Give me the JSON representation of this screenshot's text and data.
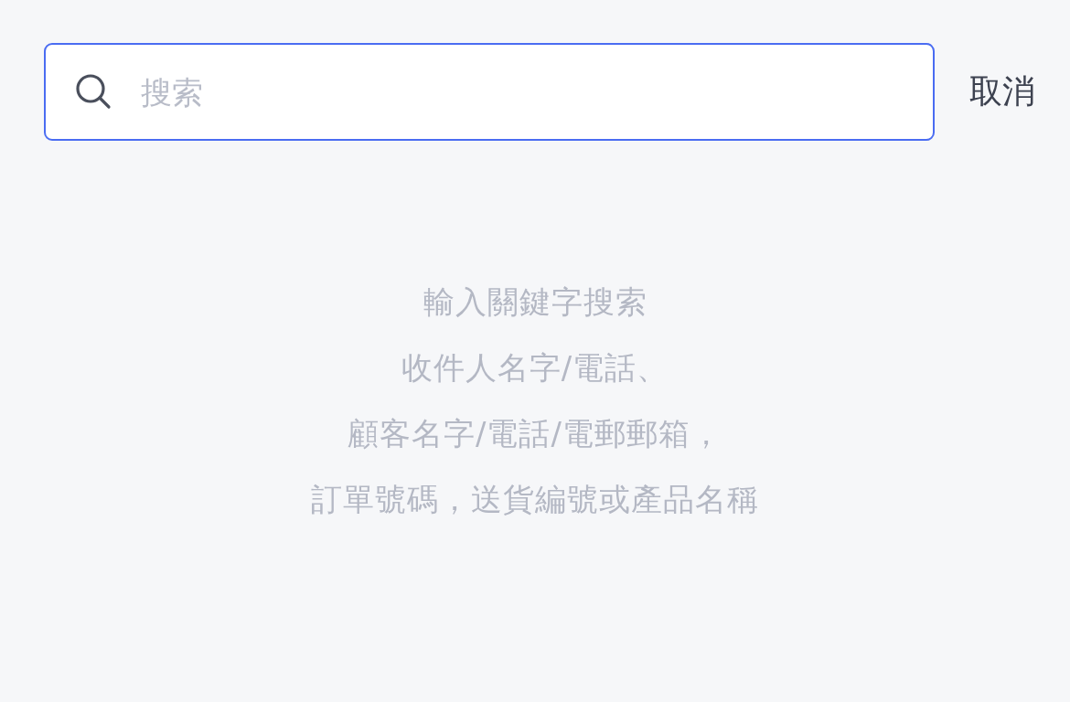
{
  "search": {
    "placeholder": "搜索"
  },
  "cancel": "取消",
  "hint_lines": [
    "輸入關鍵字搜索",
    "收件人名字/電話、",
    "顧客名字/電話/電郵郵箱，",
    "訂單號碼，送貨編號或產品名稱"
  ]
}
